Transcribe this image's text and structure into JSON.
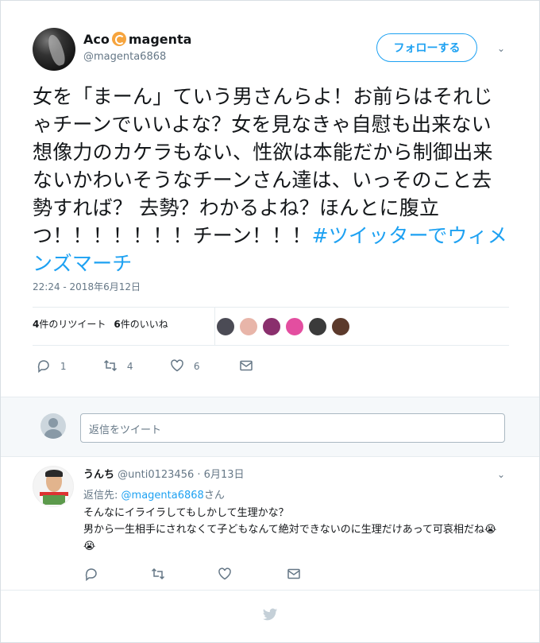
{
  "tweet": {
    "display_name": "Aco",
    "display_name_suffix": "magenta",
    "handle": "@magenta6868",
    "follow_label": "フォローする",
    "text": "女を「まーん」ていう男さんらよ！お前らはそれじゃチーンでいいよな？女を見なきゃ自慰も出来ない想像力のカケラもない、性欲は本能だから制御出来ないかわいそうなチーンさん達は、いっそのこと去勢すれば？ 去勢？わかるよね？ほんとに腹立つ！！！！！！！チーン！！！",
    "hashtag": "#ツイッターでウィメンズマーチ",
    "timestamp": "22:24 - 2018年6月12日",
    "retweets_count": "4",
    "retweets_label": "件のリツイート",
    "likes_count": "6",
    "likes_label": "件のいいね",
    "actions": {
      "reply_count": "1",
      "retweet_count": "4",
      "like_count": "6"
    },
    "icon_names": [
      "reply-icon",
      "retweet-icon",
      "heart-icon",
      "message-icon"
    ]
  },
  "reply_box": {
    "placeholder": "返信をツイート"
  },
  "reply": {
    "display_name": "うんち",
    "handle": "@unti0123456",
    "dot": "·",
    "date": "6月13日",
    "replying_to_prefix": "返信先:",
    "replying_to_handle": "@magenta6868",
    "replying_to_suffix": "さん",
    "line1": "そんなにイライラしてもしかして生理かな？",
    "line2": "男から一生相手にされなくて子どもなんて絶対できないのに生理だけあって可哀相だね😭😭"
  },
  "colors": {
    "accent": "#1da1f2",
    "text": "#14171a",
    "muted": "#657786",
    "divider": "#e6ecf0"
  },
  "liker_colors": [
    "#4b4b55",
    "#e8b5a9",
    "#8a2f6d",
    "#e34ea0",
    "#3b3b3b",
    "#5c3a2c"
  ]
}
